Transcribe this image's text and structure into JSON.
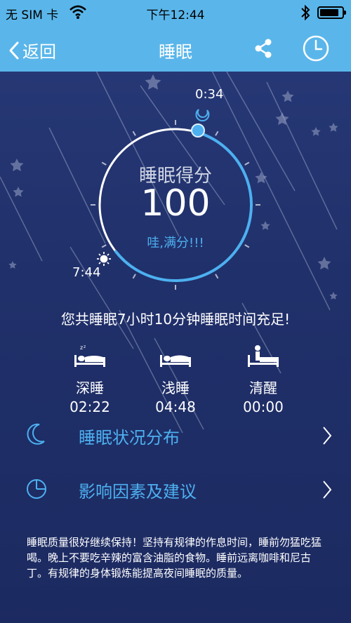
{
  "status_bar": {
    "carrier": "无 SIM 卡",
    "time": "下午12:44",
    "battery_level": 0.85
  },
  "nav": {
    "back_label": "返回",
    "title": "睡眠",
    "share_icon": "share-icon",
    "history_icon": "clock-history-icon"
  },
  "dial": {
    "score_label": "睡眠得分",
    "score": "100",
    "comment": "哇,满分!!!",
    "sleep_start": "0:34",
    "wake_time": "7:44",
    "start_icon": "moon-icon",
    "end_icon": "sun-icon",
    "accent_color": "#4db0f0"
  },
  "summary": "您共睡眠7小时10分钟睡眠时间充足!",
  "stages": [
    {
      "name": "深睡",
      "duration": "02:22",
      "icon": "deep-sleep-bed-icon"
    },
    {
      "name": "浅睡",
      "duration": "04:48",
      "icon": "light-sleep-bed-icon"
    },
    {
      "name": "清醒",
      "duration": "00:00",
      "icon": "awake-bed-icon"
    }
  ],
  "menu": [
    {
      "label": "睡眠状况分布",
      "icon": "crescent-moon-icon"
    },
    {
      "label": "影响因素及建议",
      "icon": "pie-chart-icon"
    }
  ],
  "advice": "睡眠质量很好继续保持！坚持有规律的作息时间，睡前勿猛吃猛喝。晚上不要吃辛辣的富含油脂的食物。睡前远离咖啡和尼古丁。有规律的身体锻炼能提高夜间睡眠的质量。",
  "colors": {
    "header": "#5ab6ea",
    "background": "#243570",
    "accent": "#4db0f0"
  }
}
